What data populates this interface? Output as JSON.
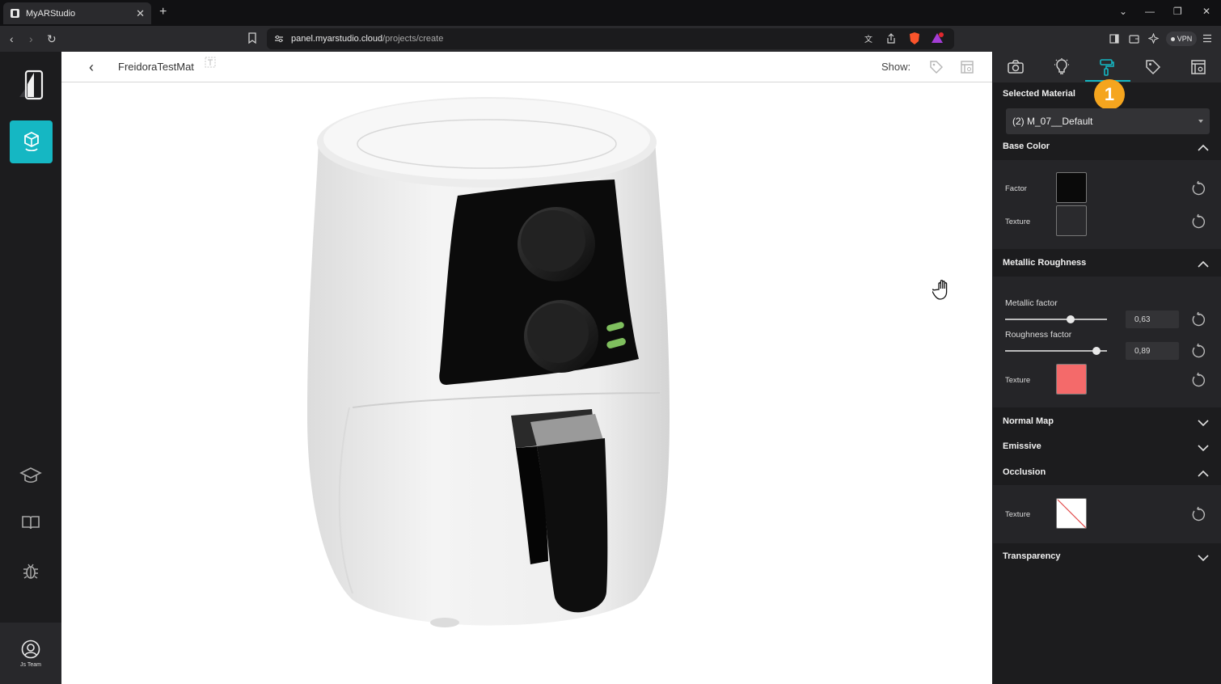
{
  "browser": {
    "tab_title": "MyARStudio",
    "url_host": "panel.myarstudio.cloud",
    "url_path": "/projects/create",
    "vpn_label": "VPN"
  },
  "rail": {
    "team_label": "Js Team",
    "accent_color": "#15b7c3"
  },
  "viewport": {
    "project_name": "FreidoraTestMat",
    "show_label": "Show:"
  },
  "panel": {
    "badge": "1",
    "selected_material_label": "Selected Material",
    "selected_material_value": "(2) M_07__Default",
    "base_color": {
      "title": "Base Color",
      "factor_label": "Factor",
      "texture_label": "Texture"
    },
    "metallic_roughness": {
      "title": "Metallic Roughness",
      "metallic_label": "Metallic factor",
      "metallic_value": "0,63",
      "roughness_label": "Roughness factor",
      "roughness_value": "0,89",
      "texture_label": "Texture",
      "texture_color": "#f46a6a"
    },
    "normal_map": {
      "title": "Normal Map"
    },
    "emissive": {
      "title": "Emissive"
    },
    "occlusion": {
      "title": "Occlusion",
      "texture_label": "Texture"
    },
    "transparency": {
      "title": "Transparency"
    }
  }
}
